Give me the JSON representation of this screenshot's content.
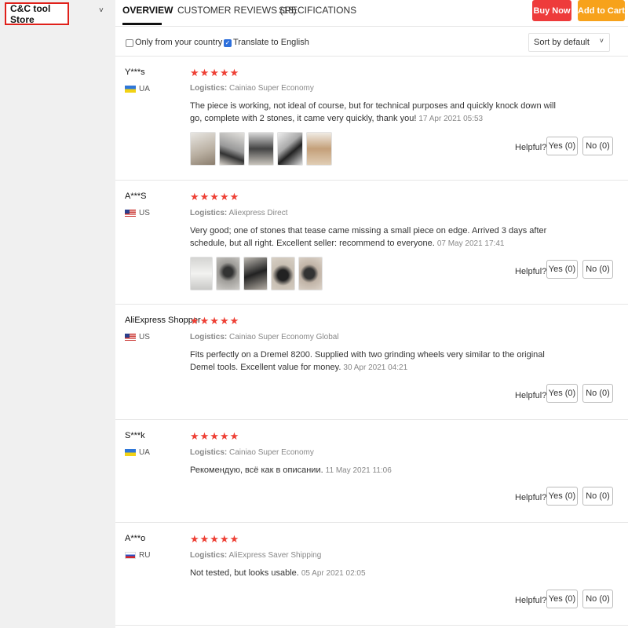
{
  "store": {
    "name": "C&C tool Store",
    "chevron": "˅"
  },
  "tabs": [
    {
      "label": "OVERVIEW",
      "active": true
    },
    {
      "label": "CUSTOMER REVIEWS (18)",
      "active": false
    },
    {
      "label": "SPECIFICATIONS",
      "active": false
    }
  ],
  "actions": {
    "buy_now": "Buy Now",
    "add_to_cart": "Add to Cart"
  },
  "filters": {
    "only_country": {
      "label": "Only from your country",
      "checked": false
    },
    "translate": {
      "label": "Translate to English",
      "checked": true
    },
    "sort": "Sort by default"
  },
  "helpful_label": "Helpful?",
  "stars": "★★★★★",
  "reviews": [
    {
      "user": "Y***s",
      "country": "UA",
      "logistics_label": "Logistics:",
      "logistics": "Cainiao Super Economy",
      "text": "The piece is working, not ideal of course, but for technical purposes and quickly knock down will go, complete with 2 stones, it came very quickly, thank you!",
      "date": "17 Apr 2021 05:53",
      "yes": "Yes (0)",
      "no": "No (0)"
    },
    {
      "user": "A***S",
      "country": "US",
      "logistics_label": "Logistics:",
      "logistics": "Aliexpress Direct",
      "text": "Very good; one of stones that tease came missing a small piece on edge. Arrived 3 days after schedule, but all right. Excellent seller: recommend to everyone.",
      "date": "07 May 2021 17:41",
      "yes": "Yes (0)",
      "no": "No (0)"
    },
    {
      "user": "AliExpress Shopper",
      "country": "US",
      "logistics_label": "Logistics:",
      "logistics": "Cainiao Super Economy Global",
      "text": "Fits perfectly on a Dremel 8200. Supplied with two grinding wheels very similar to the original Demel tools. Excellent value for money.",
      "date": "30 Apr 2021 04:21",
      "yes": "Yes (0)",
      "no": "No (0)"
    },
    {
      "user": "S***k",
      "country": "UA",
      "logistics_label": "Logistics:",
      "logistics": "Cainiao Super Economy",
      "text": "Рекомендую, всё как в описании.",
      "date": "11 May 2021 11:06",
      "yes": "Yes (0)",
      "no": "No (0)"
    },
    {
      "user": "A***o",
      "country": "RU",
      "logistics_label": "Logistics:",
      "logistics": "AliExpress Saver Shipping",
      "text": "Not tested, but looks usable.",
      "date": "05 Apr 2021 02:05",
      "yes": "Yes (0)",
      "no": "No (0)"
    }
  ],
  "colors": {
    "accent_red": "#ee3b3b",
    "accent_orange": "#f7a21b",
    "star": "#ee4035"
  }
}
